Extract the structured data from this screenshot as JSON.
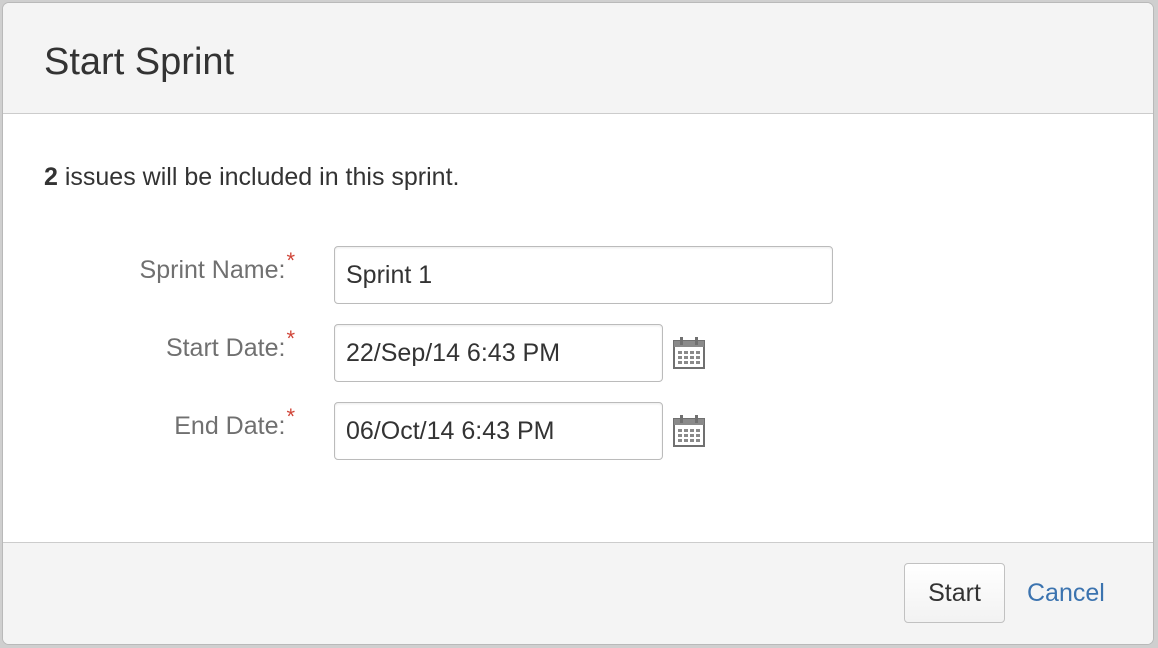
{
  "dialog": {
    "title": "Start Sprint",
    "summary_count": "2",
    "summary_text": " issues will be included in this sprint."
  },
  "form": {
    "required_marker": "*",
    "sprint_name": {
      "label": "Sprint Name:",
      "value": "Sprint 1"
    },
    "start_date": {
      "label": "Start Date:",
      "value": "22/Sep/14 6:43 PM",
      "icon": "calendar-icon"
    },
    "end_date": {
      "label": "End Date:",
      "value": "06/Oct/14 6:43 PM",
      "icon": "calendar-icon"
    }
  },
  "footer": {
    "start_label": "Start",
    "cancel_label": "Cancel"
  },
  "colors": {
    "required": "#d04437",
    "link": "#3b73af",
    "header_bg": "#f4f4f4"
  }
}
